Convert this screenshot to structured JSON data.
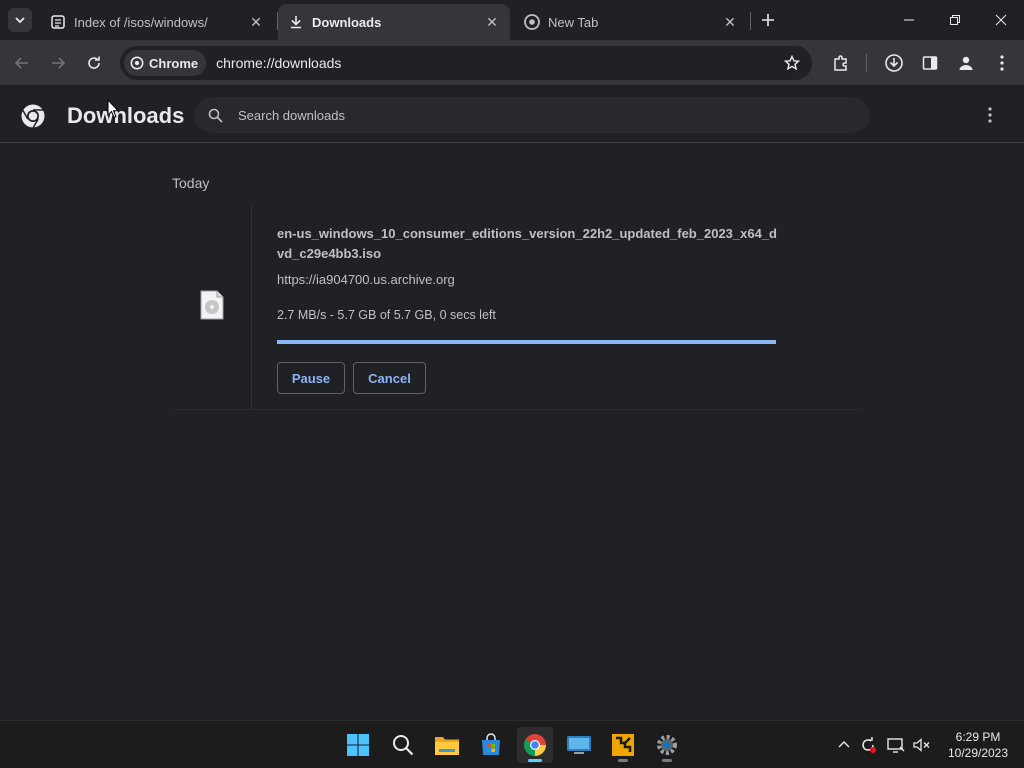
{
  "browser": {
    "tabs": [
      {
        "title": "Index of /isos/windows/",
        "icon": "archive-favicon"
      },
      {
        "title": "Downloads",
        "icon": "download-icon"
      },
      {
        "title": "New Tab",
        "icon": "chrome-icon"
      }
    ],
    "omnibox": {
      "chip_label": "Chrome",
      "url": "chrome://downloads"
    }
  },
  "downloads_page": {
    "title": "Downloads",
    "search_placeholder": "Search downloads",
    "date_group": "Today",
    "items": [
      {
        "file_name": "en-us_windows_10_consumer_editions_version_22h2_updated_feb_2023_x64_dvd_c29e4bb3.iso",
        "source_url": "https://ia904700.us.archive.org",
        "status": "2.7 MB/s - 5.7 GB of 5.7 GB, 0 secs left",
        "progress_percent": 100,
        "pause_label": "Pause",
        "cancel_label": "Cancel"
      }
    ]
  },
  "taskbar": {
    "apps": [
      "start-icon",
      "search-icon",
      "file-explorer-icon",
      "microsoft-store-icon",
      "chrome-icon",
      "remote-desktop-icon",
      "archive-tool-icon",
      "settings-icon"
    ],
    "clock": {
      "time": "6:29 PM",
      "date": "10/29/2023"
    }
  },
  "colors": {
    "accent": "#8ab4f8",
    "background": "#202124",
    "toolbar": "#35363a"
  }
}
